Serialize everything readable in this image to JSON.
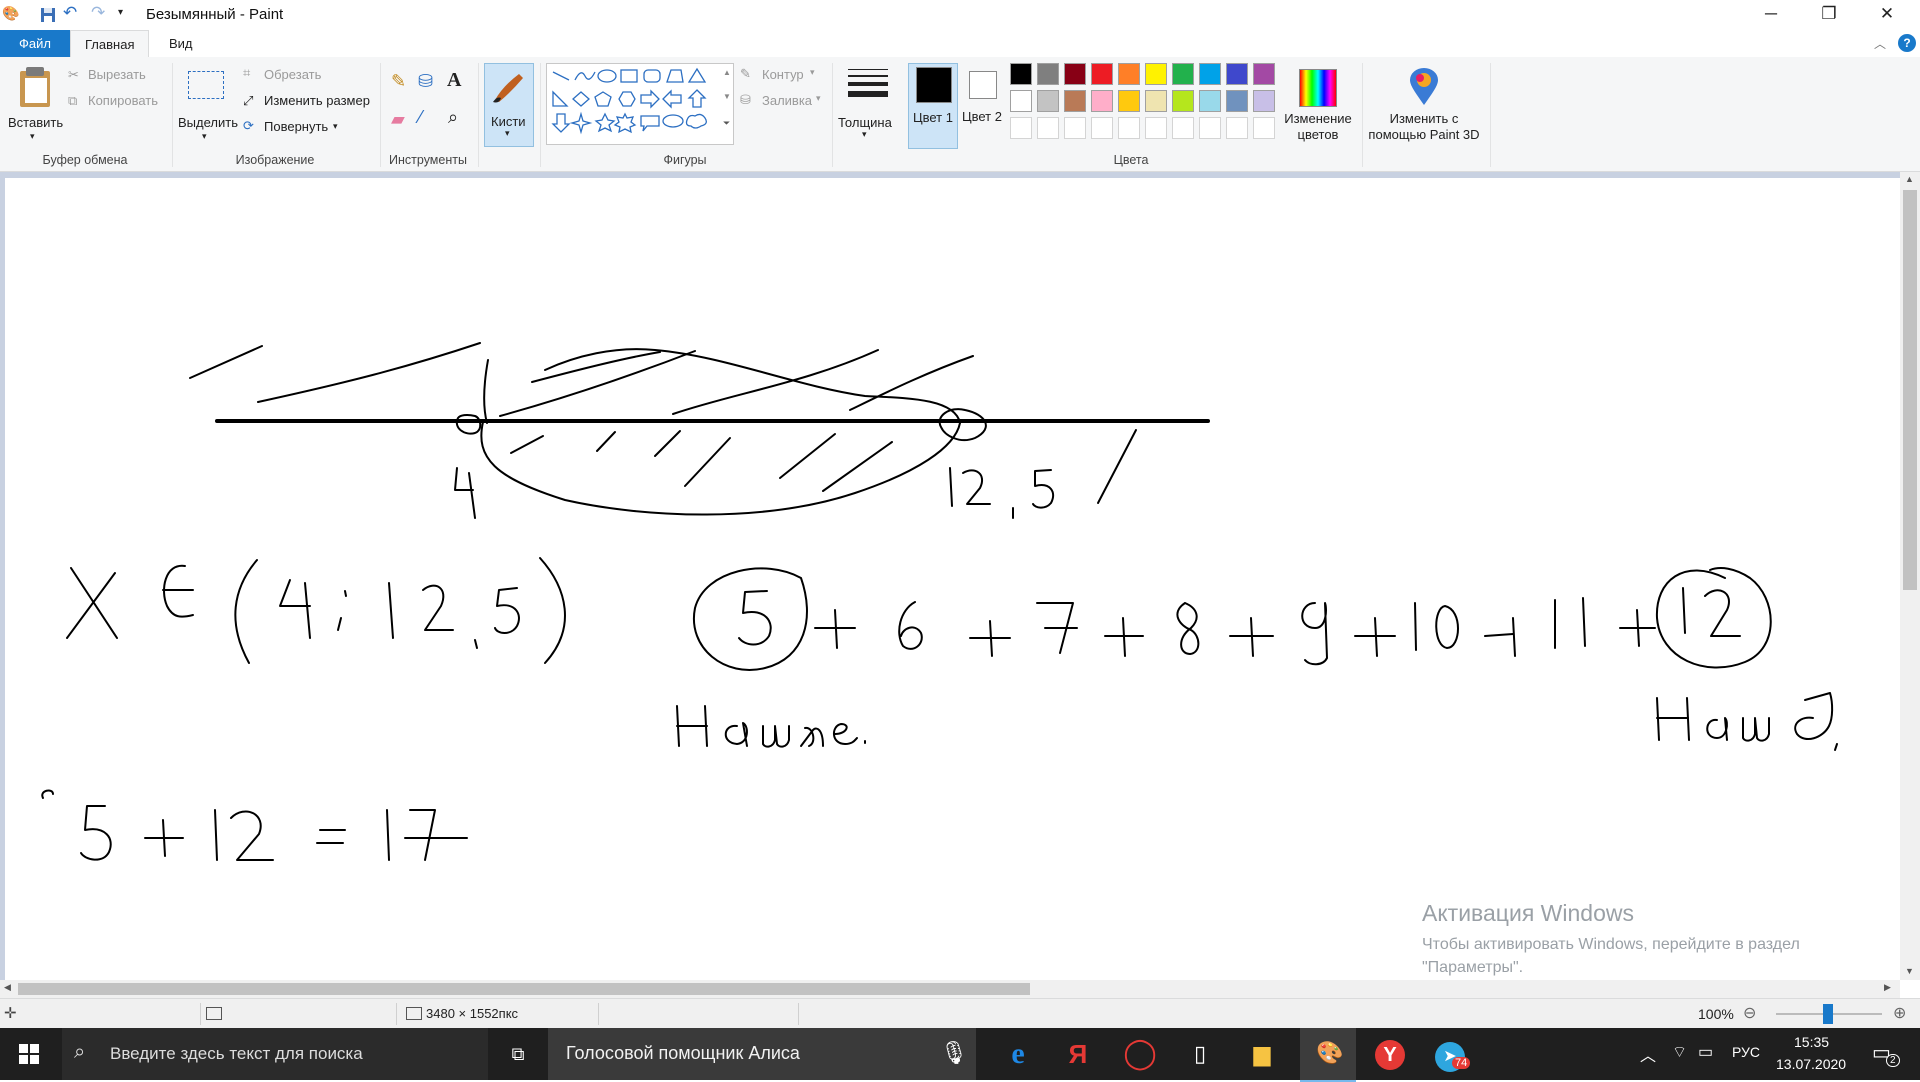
{
  "window": {
    "title": "Безымянный - Paint",
    "controls": {
      "minimize": "─",
      "maximize": "❐",
      "close": "✕"
    }
  },
  "tabs": [
    {
      "label": "Файл"
    },
    {
      "label": "Главная"
    },
    {
      "label": "Вид"
    }
  ],
  "ribbon": {
    "clipboard": {
      "paste": "Вставить",
      "cut": "Вырезать",
      "copy": "Копировать",
      "group": "Буфер обмена"
    },
    "image": {
      "select": "Выделить",
      "crop": "Обрезать",
      "resize": "Изменить размер",
      "rotate": "Повернуть",
      "group": "Изображение"
    },
    "tools": {
      "group": "Инструменты"
    },
    "brushes": {
      "label": "Кисти"
    },
    "shapes": {
      "outline": "Контур",
      "fill": "Заливка",
      "group": "Фигуры"
    },
    "thickness": {
      "label": "Толщина"
    },
    "colors": {
      "color1": "Цвет 1",
      "color2": "Цвет 2",
      "edit": "Изменение цветов",
      "group": "Цвета",
      "row1": [
        "#000000",
        "#7f7f7f",
        "#880015",
        "#ed1c24",
        "#ff7f27",
        "#fff200",
        "#22b14c",
        "#00a2e8",
        "#3f48cc",
        "#a349a4"
      ],
      "row2": [
        "#ffffff",
        "#c3c3c3",
        "#b97a57",
        "#ffaec9",
        "#ffc90e",
        "#efe4b0",
        "#b5e61d",
        "#99d9ea",
        "#7092be",
        "#c8bfe7"
      ],
      "active1": "#000000",
      "active2": "#ffffff"
    },
    "paint3d": {
      "label": "Изменить с помощью Paint 3D"
    }
  },
  "watermark": {
    "title": "Активация Windows",
    "line1": "Чтобы активировать Windows, перейдите в раздел",
    "line2": "\"Параметры\"."
  },
  "status": {
    "size": "3480 × 1552пкс",
    "zoom": "100%"
  },
  "taskbar": {
    "search_placeholder": "Введите здесь текст для поиска",
    "alice": "Голосовой помощник Алиса",
    "lang": "РУС",
    "time": "15:35",
    "date": "13.07.2020",
    "telegram_badge": "74",
    "notif_count": "2"
  }
}
